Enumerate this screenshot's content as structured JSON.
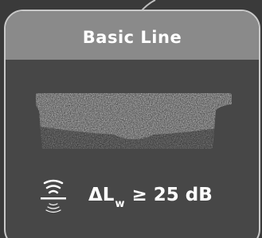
{
  "card": {
    "title": "Basic Line"
  },
  "rating": {
    "symbol": "ΔL",
    "subscript": "w",
    "comparator": "≥",
    "value": "25 dB"
  },
  "icons": {
    "sound": "sound-reduction-icon",
    "material": "acoustic-mat-texture"
  },
  "colors": {
    "background": "#3a3a3a",
    "card_body": "#474747",
    "card_header": "#8a8a8a",
    "card_border": "#c9c9c9",
    "text": "#ffffff"
  }
}
